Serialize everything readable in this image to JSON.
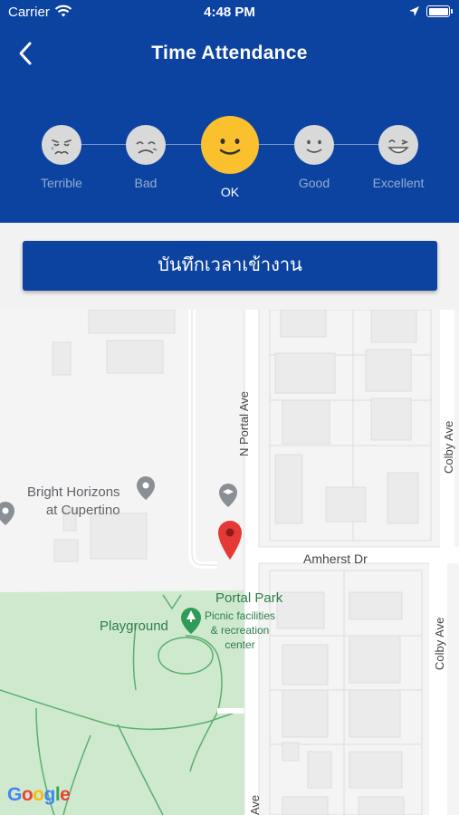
{
  "status": {
    "carrier": "Carrier",
    "time": "4:48 PM"
  },
  "header": {
    "title": "Time Attendance"
  },
  "ratings": [
    {
      "label": "Terrible",
      "selected": false
    },
    {
      "label": "Bad",
      "selected": false
    },
    {
      "label": "OK",
      "selected": true
    },
    {
      "label": "Good",
      "selected": false
    },
    {
      "label": "Excellent",
      "selected": false
    }
  ],
  "checkin_button": "บันทึกเวลาเข้างาน",
  "map": {
    "places": {
      "school": "Bright Horizons\nat Cupertino",
      "park_name": "Portal Park",
      "park_desc": "Picnic facilities\n& recreation\ncenter",
      "playground": "Playground"
    },
    "streets": {
      "n_portal": "N Portal Ave",
      "amherst": "Amherst Dr",
      "colby_top": "Colby Ave",
      "colby_bottom": "Colby Ave",
      "ave_bottom": "Ave"
    },
    "attribution": "Google"
  },
  "colors": {
    "header_bg": "#0d43a0",
    "selected_face": "#fbc02d",
    "face": "#d9d9d9",
    "pin": "#e53935",
    "park": "#c8e6c9"
  }
}
